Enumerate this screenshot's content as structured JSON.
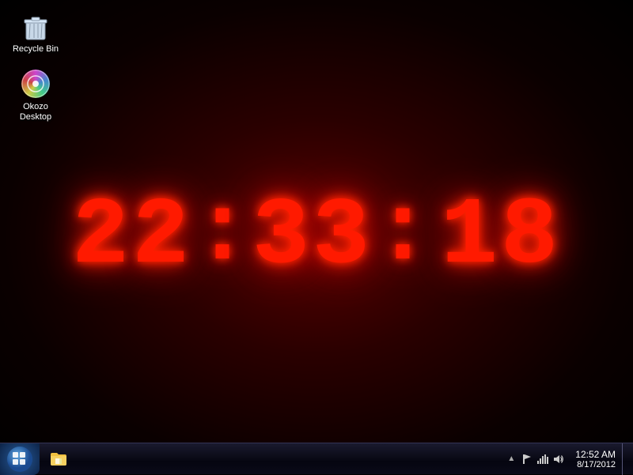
{
  "desktop": {
    "background": "dark-red-radial"
  },
  "icons": [
    {
      "id": "recycle-bin",
      "label": "Recycle Bin",
      "type": "recycle-bin"
    },
    {
      "id": "okozo-desktop",
      "label": "Okozo\nDesktop",
      "label_line1": "Okozo",
      "label_line2": "Desktop",
      "type": "okozo"
    }
  ],
  "clock": {
    "hours": "22",
    "minutes": "33",
    "seconds": "18",
    "colon1": ":",
    "colon2": ":"
  },
  "taskbar": {
    "start_label": "Start",
    "pinned": [
      {
        "id": "windows-explorer",
        "label": "Windows Explorer"
      }
    ],
    "tray": {
      "time": "12:52 AM",
      "date": "8/17/2012",
      "icons": [
        "up-arrow",
        "flag",
        "network",
        "volume"
      ]
    }
  }
}
